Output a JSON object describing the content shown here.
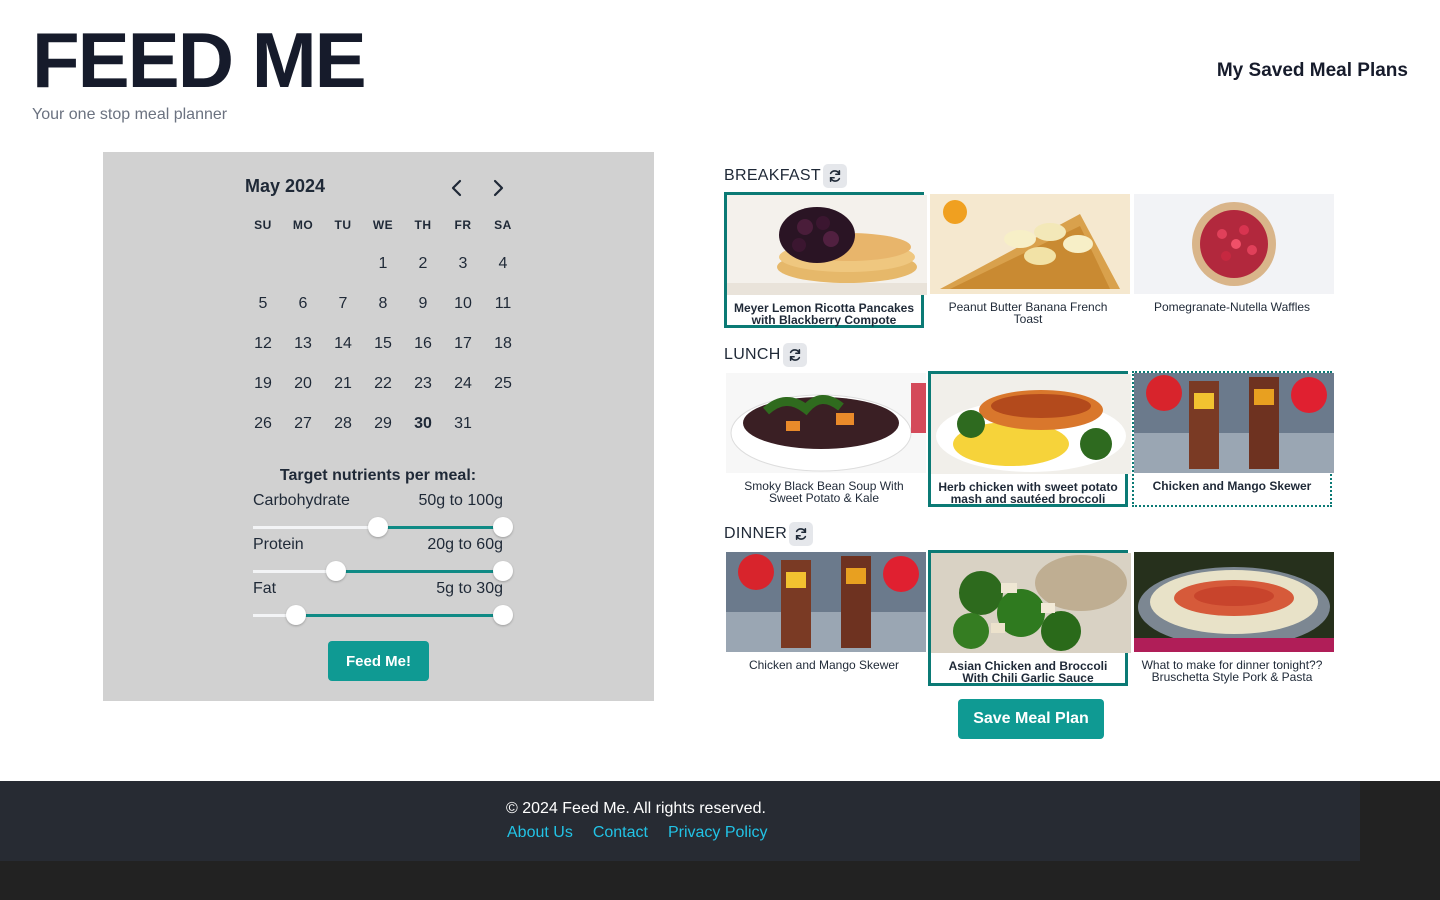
{
  "header": {
    "title": "FEED ME",
    "tagline": "Your one stop meal planner",
    "saved_link": "My Saved Meal Plans"
  },
  "calendar": {
    "month_title": "May 2024",
    "weekdays": [
      "SU",
      "MO",
      "TU",
      "WE",
      "TH",
      "FR",
      "SA"
    ],
    "days": [
      "",
      "",
      "",
      "1",
      "2",
      "3",
      "4",
      "5",
      "6",
      "7",
      "8",
      "9",
      "10",
      "11",
      "12",
      "13",
      "14",
      "15",
      "16",
      "17",
      "18",
      "19",
      "20",
      "21",
      "22",
      "23",
      "24",
      "25",
      "26",
      "27",
      "28",
      "29",
      "30",
      "31"
    ],
    "selected_day": "30"
  },
  "nutrients": {
    "heading": "Target nutrients per meal:",
    "items": [
      {
        "label": "Carbohydrate",
        "range": "50g to 100g",
        "low": 0.5,
        "high": 1.0
      },
      {
        "label": "Protein",
        "range": "20g to 60g",
        "low": 0.33,
        "high": 1.0
      },
      {
        "label": "Fat",
        "range": "5g to 30g",
        "low": 0.17,
        "high": 1.0
      }
    ],
    "feed_button": "Feed Me!"
  },
  "meals": {
    "sections": [
      {
        "title": "BREAKFAST",
        "cards": [
          {
            "caption": "Meyer Lemon Ricotta Pancakes with Blackberry Compote",
            "state": "selected"
          },
          {
            "caption": "Peanut Butter Banana French Toast",
            "state": ""
          },
          {
            "caption": "Pomegranate-Nutella Waffles",
            "state": ""
          }
        ]
      },
      {
        "title": "LUNCH",
        "cards": [
          {
            "caption": "Smoky Black Bean Soup With Sweet Potato & Kale",
            "state": ""
          },
          {
            "caption": "Herb chicken with sweet potato mash and sautéed broccoli",
            "state": "selected"
          },
          {
            "caption": "Chicken and Mango Skewer",
            "state": "alt"
          }
        ]
      },
      {
        "title": "DINNER",
        "cards": [
          {
            "caption": "Chicken and Mango Skewer",
            "state": ""
          },
          {
            "caption": "Asian Chicken and Broccoli With Chili Garlic Sauce",
            "state": "selected"
          },
          {
            "caption": "What to make for dinner tonight?? Bruschetta Style Pork & Pasta",
            "state": ""
          }
        ]
      }
    ],
    "save_button": "Save Meal Plan"
  },
  "footer": {
    "copyright": "© 2024 Feed Me. All rights reserved.",
    "links": [
      "About Us",
      "Contact",
      "Privacy Policy"
    ]
  },
  "colors": {
    "accent": "#0f9a93",
    "selected_border": "#0b7a75",
    "panel": "#d1d1d1",
    "footer": "#272b33",
    "link": "#22c3e6"
  }
}
